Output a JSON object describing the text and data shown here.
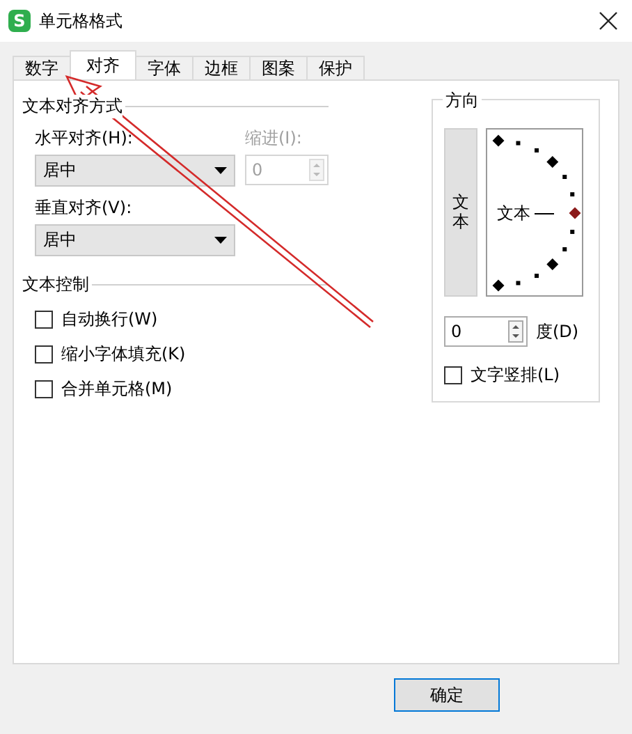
{
  "window": {
    "icon": "S",
    "title": "单元格格式"
  },
  "tabs": [
    {
      "label": "数字",
      "selected": false
    },
    {
      "label": "对齐",
      "selected": true
    },
    {
      "label": "字体",
      "selected": false
    },
    {
      "label": "边框",
      "selected": false
    },
    {
      "label": "图案",
      "selected": false
    },
    {
      "label": "保护",
      "selected": false
    }
  ],
  "alignment": {
    "title": "文本对齐方式",
    "horizontal": {
      "label": "水平对齐(H):",
      "value": "居中"
    },
    "indent": {
      "label": "缩进(I):",
      "value": "0",
      "disabled": true
    },
    "vertical": {
      "label": "垂直对齐(V):",
      "value": "居中"
    }
  },
  "text_control": {
    "title": "文本控制",
    "options": [
      {
        "label": "自动换行(W)",
        "checked": false
      },
      {
        "label": "缩小字体填充(K)",
        "checked": false
      },
      {
        "label": "合并单元格(M)",
        "checked": false
      }
    ]
  },
  "orientation": {
    "title": "方向",
    "vertical_text_button": "文本",
    "dial_text": "文本",
    "degrees": {
      "value": "0",
      "label": "度(D)"
    },
    "stacked_text": {
      "label": "文字竖排(L)",
      "checked": false
    }
  },
  "buttons": [
    "确定"
  ]
}
